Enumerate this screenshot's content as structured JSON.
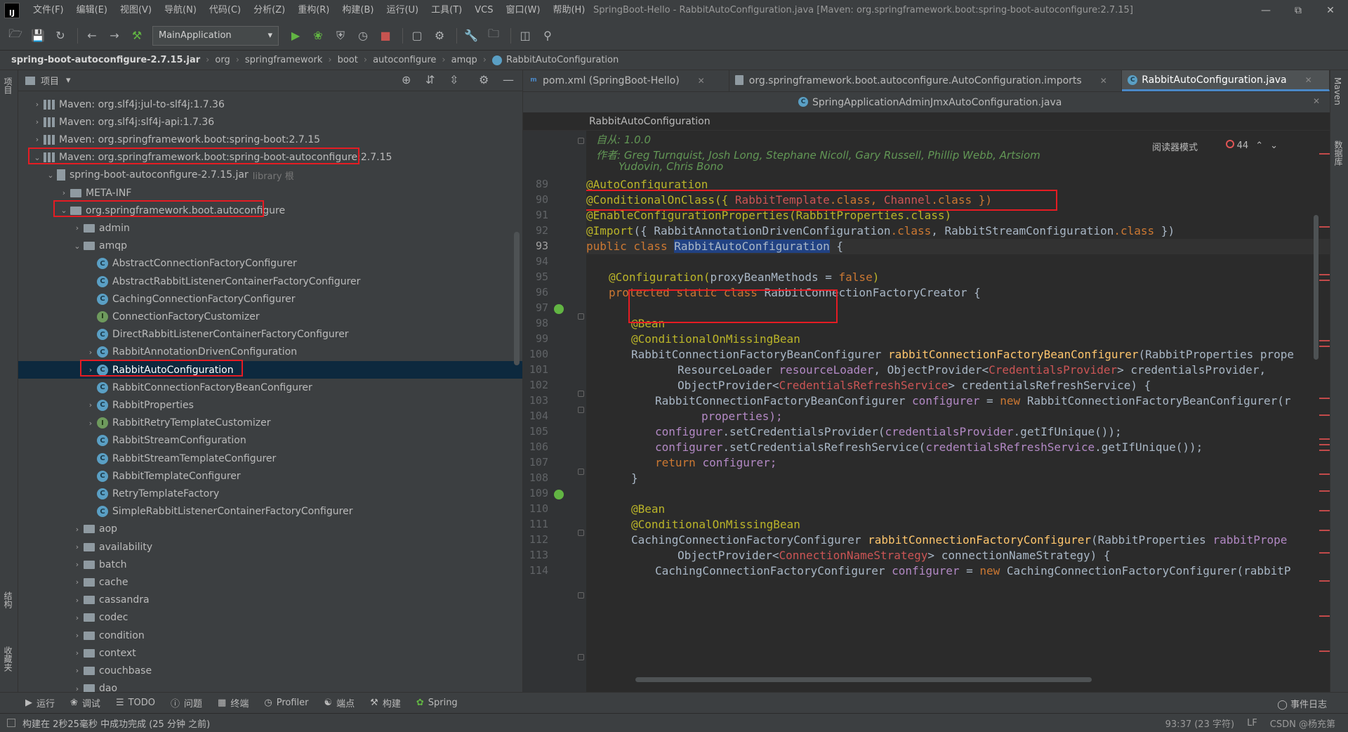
{
  "app": {
    "logo": "IJ",
    "window_title": "SpringBoot-Hello - RabbitAutoConfiguration.java [Maven: org.springframework.boot:spring-boot-autoconfigure:2.7.15]",
    "menu": [
      "文件(F)",
      "编辑(E)",
      "视图(V)",
      "导航(N)",
      "代码(C)",
      "分析(Z)",
      "重构(R)",
      "构建(B)",
      "运行(U)",
      "工具(T)",
      "VCS",
      "窗口(W)",
      "帮助(H)"
    ]
  },
  "toolbar": {
    "run_config": "MainApplication"
  },
  "breadcrumb": [
    "spring-boot-autoconfigure-2.7.15.jar",
    "org",
    "springframework",
    "boot",
    "autoconfigure",
    "amqp",
    "RabbitAutoConfiguration"
  ],
  "side_labels": {
    "left_top": "项目",
    "left_mid": "结构",
    "left_bottom": "收藏夹",
    "right_top": "Maven",
    "right_mid": "数据库"
  },
  "project": {
    "header": "项目",
    "tree": [
      {
        "depth": 0,
        "arrow": "›",
        "icon": "lib",
        "label": "Maven: org.slf4j:jul-to-slf4j:1.7.36"
      },
      {
        "depth": 0,
        "arrow": "›",
        "icon": "lib",
        "label": "Maven: org.slf4j:slf4j-api:1.7.36"
      },
      {
        "depth": 0,
        "arrow": "›",
        "icon": "lib",
        "label": "Maven: org.springframework.boot:spring-boot:2.7.15"
      },
      {
        "depth": 0,
        "arrow": "⌄",
        "icon": "lib",
        "label": "Maven: org.springframework.boot:spring-boot-autoconfigure:2.7.15"
      },
      {
        "depth": 1,
        "arrow": "⌄",
        "icon": "jar",
        "label": "spring-boot-autoconfigure-2.7.15.jar",
        "suffix": "library 根"
      },
      {
        "depth": 2,
        "arrow": "›",
        "icon": "folder",
        "label": "META-INF"
      },
      {
        "depth": 2,
        "arrow": "⌄",
        "icon": "folder",
        "label": "org.springframework.boot.autoconfigure"
      },
      {
        "depth": 3,
        "arrow": "›",
        "icon": "folder",
        "label": "admin"
      },
      {
        "depth": 3,
        "arrow": "⌄",
        "icon": "folder",
        "label": "amqp"
      },
      {
        "depth": 4,
        "arrow": "",
        "icon": "cls",
        "label": "AbstractConnectionFactoryConfigurer"
      },
      {
        "depth": 4,
        "arrow": "",
        "icon": "cls",
        "label": "AbstractRabbitListenerContainerFactoryConfigurer"
      },
      {
        "depth": 4,
        "arrow": "",
        "icon": "cls",
        "label": "CachingConnectionFactoryConfigurer"
      },
      {
        "depth": 4,
        "arrow": "",
        "icon": "intf",
        "label": "ConnectionFactoryCustomizer"
      },
      {
        "depth": 4,
        "arrow": "",
        "icon": "cls",
        "label": "DirectRabbitListenerContainerFactoryConfigurer"
      },
      {
        "depth": 4,
        "arrow": "›",
        "icon": "cls",
        "label": "RabbitAnnotationDrivenConfiguration"
      },
      {
        "depth": 4,
        "arrow": "›",
        "icon": "cls",
        "label": "RabbitAutoConfiguration",
        "selected": true
      },
      {
        "depth": 4,
        "arrow": "",
        "icon": "cls",
        "label": "RabbitConnectionFactoryBeanConfigurer"
      },
      {
        "depth": 4,
        "arrow": "›",
        "icon": "cls",
        "label": "RabbitProperties"
      },
      {
        "depth": 4,
        "arrow": "›",
        "icon": "intf",
        "label": "RabbitRetryTemplateCustomizer"
      },
      {
        "depth": 4,
        "arrow": "",
        "icon": "cls",
        "label": "RabbitStreamConfiguration"
      },
      {
        "depth": 4,
        "arrow": "",
        "icon": "cls",
        "label": "RabbitStreamTemplateConfigurer"
      },
      {
        "depth": 4,
        "arrow": "",
        "icon": "cls",
        "label": "RabbitTemplateConfigurer"
      },
      {
        "depth": 4,
        "arrow": "",
        "icon": "cls",
        "label": "RetryTemplateFactory"
      },
      {
        "depth": 4,
        "arrow": "",
        "icon": "cls",
        "label": "SimpleRabbitListenerContainerFactoryConfigurer"
      },
      {
        "depth": 3,
        "arrow": "›",
        "icon": "folder",
        "label": "aop"
      },
      {
        "depth": 3,
        "arrow": "›",
        "icon": "folder",
        "label": "availability"
      },
      {
        "depth": 3,
        "arrow": "›",
        "icon": "folder",
        "label": "batch"
      },
      {
        "depth": 3,
        "arrow": "›",
        "icon": "folder",
        "label": "cache"
      },
      {
        "depth": 3,
        "arrow": "›",
        "icon": "folder",
        "label": "cassandra"
      },
      {
        "depth": 3,
        "arrow": "›",
        "icon": "folder",
        "label": "codec"
      },
      {
        "depth": 3,
        "arrow": "›",
        "icon": "folder",
        "label": "condition"
      },
      {
        "depth": 3,
        "arrow": "›",
        "icon": "folder",
        "label": "context"
      },
      {
        "depth": 3,
        "arrow": "›",
        "icon": "folder",
        "label": "couchbase"
      },
      {
        "depth": 3,
        "arrow": "›",
        "icon": "folder",
        "label": "dao"
      }
    ]
  },
  "editor": {
    "tabs": [
      {
        "label": "pom.xml (SpringBoot-Hello)",
        "icon": "m"
      },
      {
        "label": "org.springframework.boot.autoconfigure.AutoConfiguration.imports",
        "icon": "f"
      },
      {
        "label": "RabbitAutoConfiguration.java",
        "icon": "c",
        "active": true
      }
    ],
    "tab_row2": "SpringApplicationAdminJmxAutoConfiguration.java",
    "structure": "RabbitAutoConfiguration",
    "reader_mode": "阅读器模式",
    "problems_count": "44",
    "doc": {
      "since": "自从: 1.0.0",
      "authors_1": "作者: Greg Turnquist, Josh Long, Stephane Nicoll, Gary Russell, Phillip Webb, Artsiom",
      "authors_2": "Yudovin, Chris Bono"
    },
    "line_numbers": [
      "89",
      "90",
      "91",
      "92",
      "93",
      "94",
      "95",
      "96",
      "97",
      "98",
      "99",
      "100",
      "101",
      "102",
      "103",
      "104",
      "105",
      "106",
      "107",
      "108",
      "109",
      "110",
      "111",
      "112",
      "113",
      "114"
    ],
    "code": {
      "l89": "@AutoConfiguration",
      "l90a": "@ConditionalOnClass({ ",
      "l90b": "RabbitTemplate",
      "l90c": ".class, ",
      "l90d": "Channel",
      "l90e": ".class })",
      "l91": "@EnableConfigurationProperties(RabbitProperties.class)",
      "l92a": "@Import",
      "l92b": "({ RabbitAnnotationDrivenConfiguration",
      "l92c": ".class",
      "l92d": ", RabbitStreamConfiguration",
      "l92e": ".class",
      "l92f": " })",
      "l93a": "public class ",
      "l93b": "RabbitAutoConfiguration",
      "l93c": " {",
      "l95a": "@Configuration(",
      "l95b": "proxyBeanMethods = ",
      "l95c": "false",
      "l95d": ")",
      "l96a": "protected static class ",
      "l96b": "RabbitConnectionFactoryCreator {",
      "l98": "@Bean",
      "l99": "@ConditionalOnMissingBean",
      "l100a": "RabbitConnectionFactoryBeanConfigurer ",
      "l100b": "rabbitConnectionFactoryBeanConfigurer",
      "l100c": "(RabbitProperties prope",
      "l101a": "ResourceLoader ",
      "l101b": "resourceLoader",
      "l101c": ", ObjectProvider<",
      "l101d": "CredentialsProvider",
      "l101e": "> credentialsProvider,",
      "l102a": "ObjectProvider<",
      "l102b": "CredentialsRefreshService",
      "l102c": "> credentialsRefreshService) {",
      "l103a": "RabbitConnectionFactoryBeanConfigurer ",
      "l103b": "configurer",
      "l103c": " = ",
      "l103d": "new ",
      "l103e": "RabbitConnectionFactoryBeanConfigurer(r",
      "l104": "properties);",
      "l105a": "configurer",
      "l105b": ".setCredentialsProvider(",
      "l105c": "credentialsProvider",
      "l105d": ".getIfUnique());",
      "l106a": "configurer",
      "l106b": ".setCredentialsRefreshService(",
      "l106c": "credentialsRefreshService",
      "l106d": ".getIfUnique());",
      "l107a": "return ",
      "l107b": "configurer;",
      "l108": "}",
      "l110": "@Bean",
      "l111": "@ConditionalOnMissingBean",
      "l112a": "CachingConnectionFactoryConfigurer ",
      "l112b": "rabbitConnectionFactoryConfigurer",
      "l112c": "(RabbitProperties ",
      "l112d": "rabbitPrope",
      "l113a": "ObjectProvider<",
      "l113b": "ConnectionNameStrategy",
      "l113c": "> connectionNameStrategy) {",
      "l114a": "CachingConnectionFactoryConfigurer ",
      "l114b": "configurer",
      "l114c": " = ",
      "l114d": "new ",
      "l114e": "CachingConnectionFactoryConfigurer(rabbitP"
    }
  },
  "toolwindows": [
    "运行",
    "调试",
    "TODO",
    "问题",
    "终端",
    "Profiler",
    "端点",
    "构建",
    "Spring"
  ],
  "event_log": "事件日志",
  "status": {
    "message": "构建在 2秒25毫秒 中成功完成 (25 分钟 之前)",
    "position": "93:37 (23 字符)",
    "line_sep": "LF",
    "watermark": "CSDN @杨充第"
  },
  "colors": {
    "highlight_box": "#e51c23",
    "selection": "#0d293e",
    "accent": "#4a88c7"
  }
}
